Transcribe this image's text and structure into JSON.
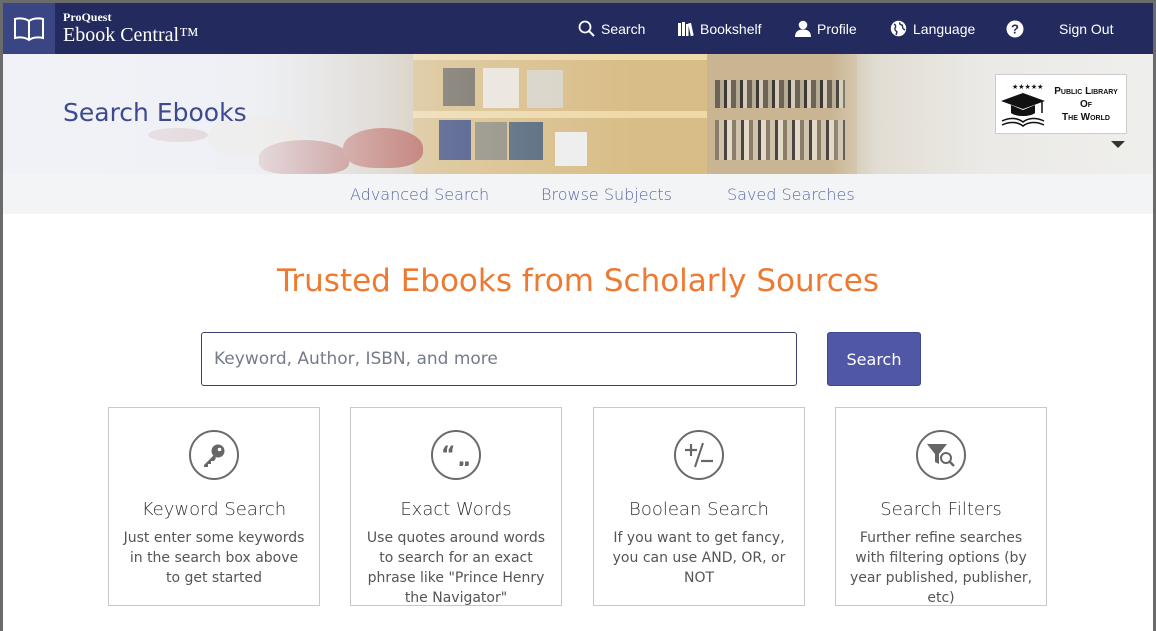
{
  "brand": {
    "top_label": "ProQuest",
    "name": "Ebook Central™"
  },
  "nav": {
    "search": "Search",
    "bookshelf": "Bookshelf",
    "profile": "Profile",
    "language": "Language",
    "help_icon": "help-icon",
    "signout": "Sign Out"
  },
  "hero": {
    "title": "Search Ebooks",
    "library_badge": {
      "line1": "Public Library",
      "line2": "Of",
      "line3": "The World"
    }
  },
  "subnav": [
    "Advanced Search",
    "Browse Subjects",
    "Saved Searches"
  ],
  "headline": "Trusted Ebooks from Scholarly Sources",
  "search": {
    "placeholder": "Keyword, Author, ISBN, and more",
    "button": "Search"
  },
  "cards": [
    {
      "icon": "key-icon",
      "title": "Keyword Search",
      "desc": "Just enter some keywords in the search box above to get started"
    },
    {
      "icon": "quotes-icon",
      "title": "Exact Words",
      "desc": "Use quotes around words to search for an exact phrase like \"Prince Henry the Navigator\""
    },
    {
      "icon": "plus-minus-icon",
      "title": "Boolean Search",
      "desc": "If you want to get fancy, you can use AND, OR, or NOT"
    },
    {
      "icon": "filter-search-icon",
      "title": "Search Filters",
      "desc": "Further refine searches with filtering options (by year published, publisher, etc)"
    }
  ],
  "colors": {
    "nav_bg": "#232b5e",
    "accent_orange": "#ee7a32",
    "link": "#5b68a8",
    "button": "#5058a6"
  }
}
